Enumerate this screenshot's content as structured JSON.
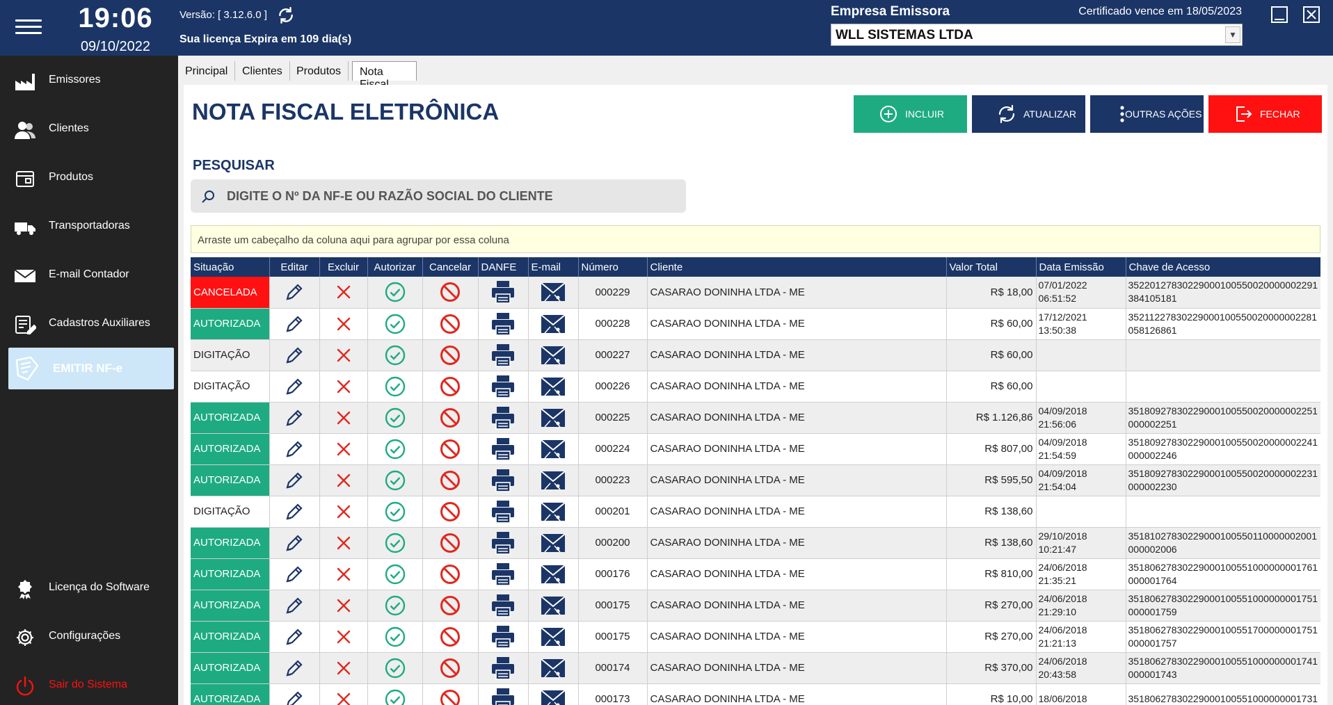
{
  "header": {
    "time": "19:06",
    "date": "09/10/2022",
    "version": "Versão: [ 3.12.6.0 ]",
    "license": "Sua licença Expira em 109 dia(s)",
    "empresa_label": "Empresa Emissora",
    "certificado": "Certificado vence em 18/05/2023",
    "empresa_selected": "WLL SISTEMAS LTDA"
  },
  "sidebar": {
    "items": [
      {
        "label": "Emissores",
        "icon": "factory-icon"
      },
      {
        "label": "Clientes",
        "icon": "users-icon"
      },
      {
        "label": "Produtos",
        "icon": "box-icon"
      },
      {
        "label": "Transportadoras",
        "icon": "truck-icon"
      },
      {
        "label": "E-mail Contador",
        "icon": "mail-icon"
      },
      {
        "label": "Cadastros Auxiliares",
        "icon": "form-edit-icon"
      }
    ],
    "emitir": "EMITIR NF-e",
    "bottom": [
      {
        "label": "Licença do Software",
        "icon": "license-icon"
      },
      {
        "label": "Configurações",
        "icon": "gear-icon"
      },
      {
        "label": "Sair do Sistema",
        "icon": "power-icon"
      }
    ]
  },
  "tabs": [
    "Principal",
    "Clientes",
    "Produtos",
    "Nota Fiscal Eletrônica"
  ],
  "page": {
    "title": "NOTA FISCAL ELETRÔNICA",
    "buttons": {
      "incluir": "INCLUIR",
      "atualizar": "ATUALIZAR",
      "outras": "OUTRAS AÇÕES",
      "fechar": "FECHAR"
    },
    "search_title": "PESQUISAR",
    "search_placeholder": "DIGITE O Nº DA NF-E OU RAZÃO SOCIAL DO CLIENTE",
    "group_hint": "Arraste um cabeçalho da coluna aqui para agrupar por essa coluna"
  },
  "colors": {
    "navy": "#1b3566",
    "green": "#1eab81",
    "red": "#ff1111",
    "light_blue": "#cde7f9"
  },
  "grid": {
    "columns": [
      "Situação",
      "Editar",
      "Excluir",
      "Autorizar",
      "Cancelar",
      "DANFE",
      "E-mail",
      "Número",
      "Cliente",
      "Valor Total",
      "Data Emissão",
      "Chave de Acesso"
    ],
    "rows": [
      {
        "situacao": "CANCELADA",
        "numero": "000229",
        "cliente": "CASARAO DONINHA LTDA - ME",
        "valor": "R$ 18,00",
        "data1": "07/01/2022",
        "data2": "06:51:52",
        "chave1": "35220127830229000100550020000002291",
        "chave2": "384105181"
      },
      {
        "situacao": "AUTORIZADA",
        "numero": "000228",
        "cliente": "CASARAO DONINHA LTDA - ME",
        "valor": "R$ 60,00",
        "data1": "17/12/2021",
        "data2": "13:50:38",
        "chave1": "35211227830229000100550020000002281",
        "chave2": "058126861"
      },
      {
        "situacao": "DIGITAÇÃO",
        "numero": "000227",
        "cliente": "CASARAO DONINHA LTDA - ME",
        "valor": "R$ 60,00",
        "data1": "",
        "data2": "",
        "chave1": "",
        "chave2": ""
      },
      {
        "situacao": "DIGITAÇÃO",
        "numero": "000226",
        "cliente": "CASARAO DONINHA LTDA - ME",
        "valor": "R$ 60,00",
        "data1": "",
        "data2": "",
        "chave1": "",
        "chave2": ""
      },
      {
        "situacao": "AUTORIZADA",
        "numero": "000225",
        "cliente": "CASARAO DONINHA LTDA - ME",
        "valor": "R$ 1.126,86",
        "data1": "04/09/2018",
        "data2": "21:56:06",
        "chave1": "35180927830229000100550020000002251",
        "chave2": "000002251"
      },
      {
        "situacao": "AUTORIZADA",
        "numero": "000224",
        "cliente": "CASARAO DONINHA LTDA - ME",
        "valor": "R$ 807,00",
        "data1": "04/09/2018",
        "data2": "21:54:59",
        "chave1": "35180927830229000100550020000002241",
        "chave2": "000002246"
      },
      {
        "situacao": "AUTORIZADA",
        "numero": "000223",
        "cliente": "CASARAO DONINHA LTDA - ME",
        "valor": "R$ 595,50",
        "data1": "04/09/2018",
        "data2": "21:54:04",
        "chave1": "35180927830229000100550020000002231",
        "chave2": "000002230"
      },
      {
        "situacao": "DIGITAÇÃO",
        "numero": "000201",
        "cliente": "CASARAO DONINHA LTDA - ME",
        "valor": "R$ 138,60",
        "data1": "",
        "data2": "",
        "chave1": "",
        "chave2": ""
      },
      {
        "situacao": "AUTORIZADA",
        "numero": "000200",
        "cliente": "CASARAO DONINHA LTDA - ME",
        "valor": "R$ 138,60",
        "data1": "29/10/2018",
        "data2": "10:21:47",
        "chave1": "35181027830229000100550110000002001",
        "chave2": "000002006"
      },
      {
        "situacao": "AUTORIZADA",
        "numero": "000176",
        "cliente": "CASARAO DONINHA LTDA - ME",
        "valor": "R$ 810,00",
        "data1": "24/06/2018",
        "data2": "21:35:21",
        "chave1": "35180627830229000100551000000001761",
        "chave2": "000001764"
      },
      {
        "situacao": "AUTORIZADA",
        "numero": "000175",
        "cliente": "CASARAO DONINHA LTDA - ME",
        "valor": "R$ 270,00",
        "data1": "24/06/2018",
        "data2": "21:29:10",
        "chave1": "35180627830229000100551000000001751",
        "chave2": "000001759"
      },
      {
        "situacao": "AUTORIZADA",
        "numero": "000175",
        "cliente": "CASARAO DONINHA LTDA - ME",
        "valor": "R$ 270,00",
        "data1": "24/06/2018",
        "data2": "21:21:13",
        "chave1": "35180627830229000100551700000001751",
        "chave2": "000001757"
      },
      {
        "situacao": "AUTORIZADA",
        "numero": "000174",
        "cliente": "CASARAO DONINHA LTDA - ME",
        "valor": "R$ 370,00",
        "data1": "24/06/2018",
        "data2": "20:43:58",
        "chave1": "35180627830229000100551000000001741",
        "chave2": "000001743"
      },
      {
        "situacao": "AUTORIZADA",
        "numero": "000173",
        "cliente": "CASARAO DONINHA LTDA - ME",
        "valor": "R$ 10,00",
        "data1": "18/06/2018",
        "data2": "",
        "chave1": "35180627830229000100551000000001731",
        "chave2": ""
      }
    ]
  }
}
